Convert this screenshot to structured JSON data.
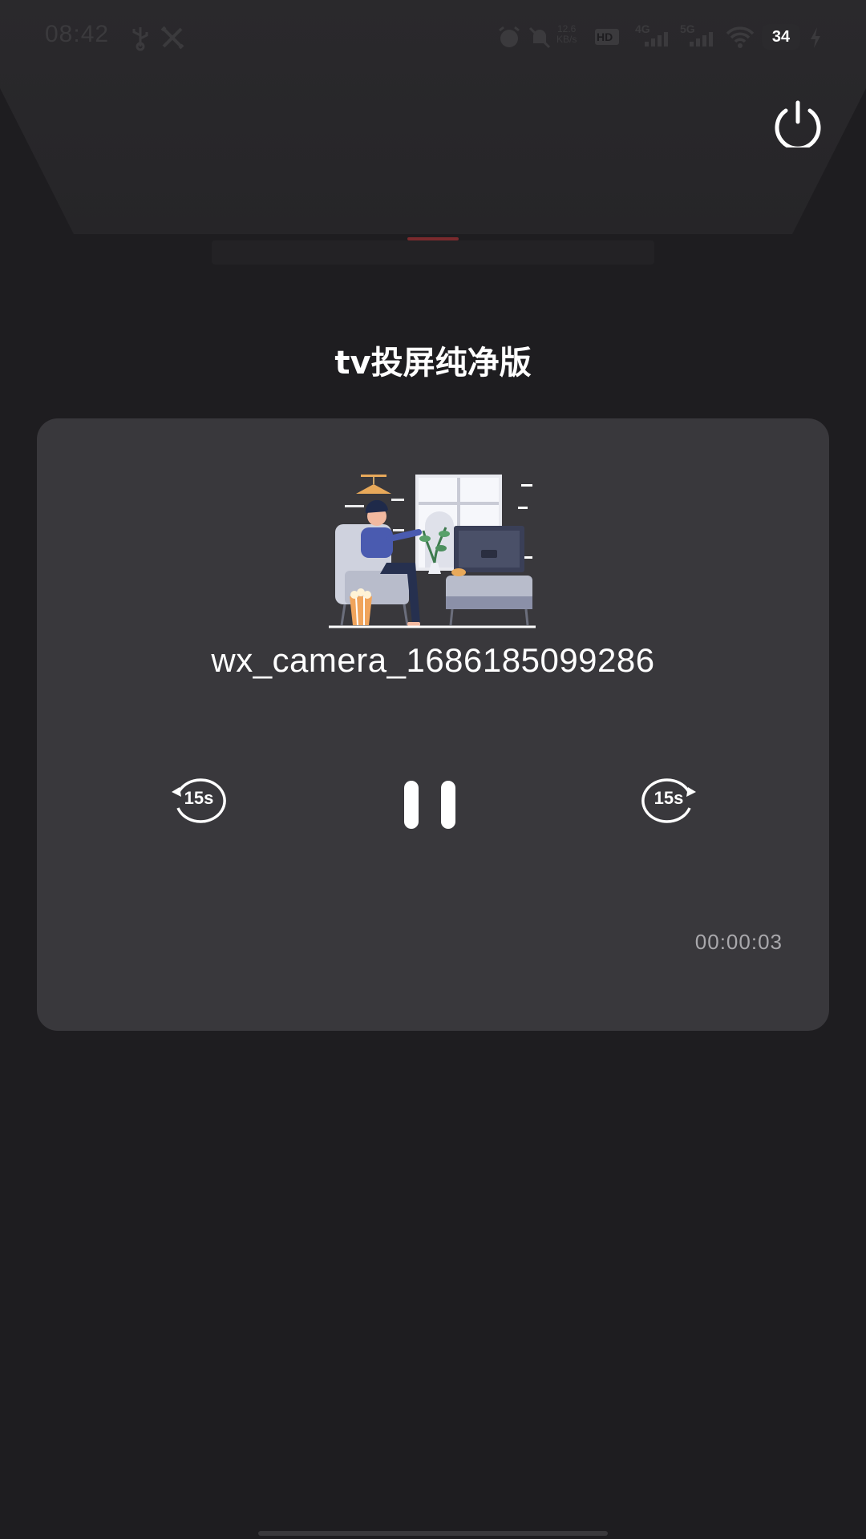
{
  "status_bar": {
    "time": "08:42",
    "icons": [
      "usb-icon",
      "tools-icon",
      "alarm-icon",
      "mute-icon",
      "hd-icon",
      "signal-4g-icon",
      "signal-5g-icon",
      "wifi-icon",
      "charging-icon"
    ],
    "net_rate_value": "12.6",
    "net_rate_unit": "KB/s",
    "hd_label": "HD",
    "sig1_label": "4G",
    "sig2_label": "5G",
    "battery_level": "34"
  },
  "header": {
    "power_icon": "power-icon"
  },
  "title": "tv投屏纯净版",
  "player": {
    "illustration": "person-watching-tv-illustration",
    "file_name": "wx_camera_1686185099286",
    "rewind_label": "15s",
    "forward_label": "15s",
    "elapsed_time": "00:00:03"
  },
  "colors": {
    "background": "#1e1d20",
    "card": "#39383c",
    "accent": "#7a2a2d",
    "text_primary": "#ffffff",
    "text_secondary": "#a9a8ac"
  }
}
